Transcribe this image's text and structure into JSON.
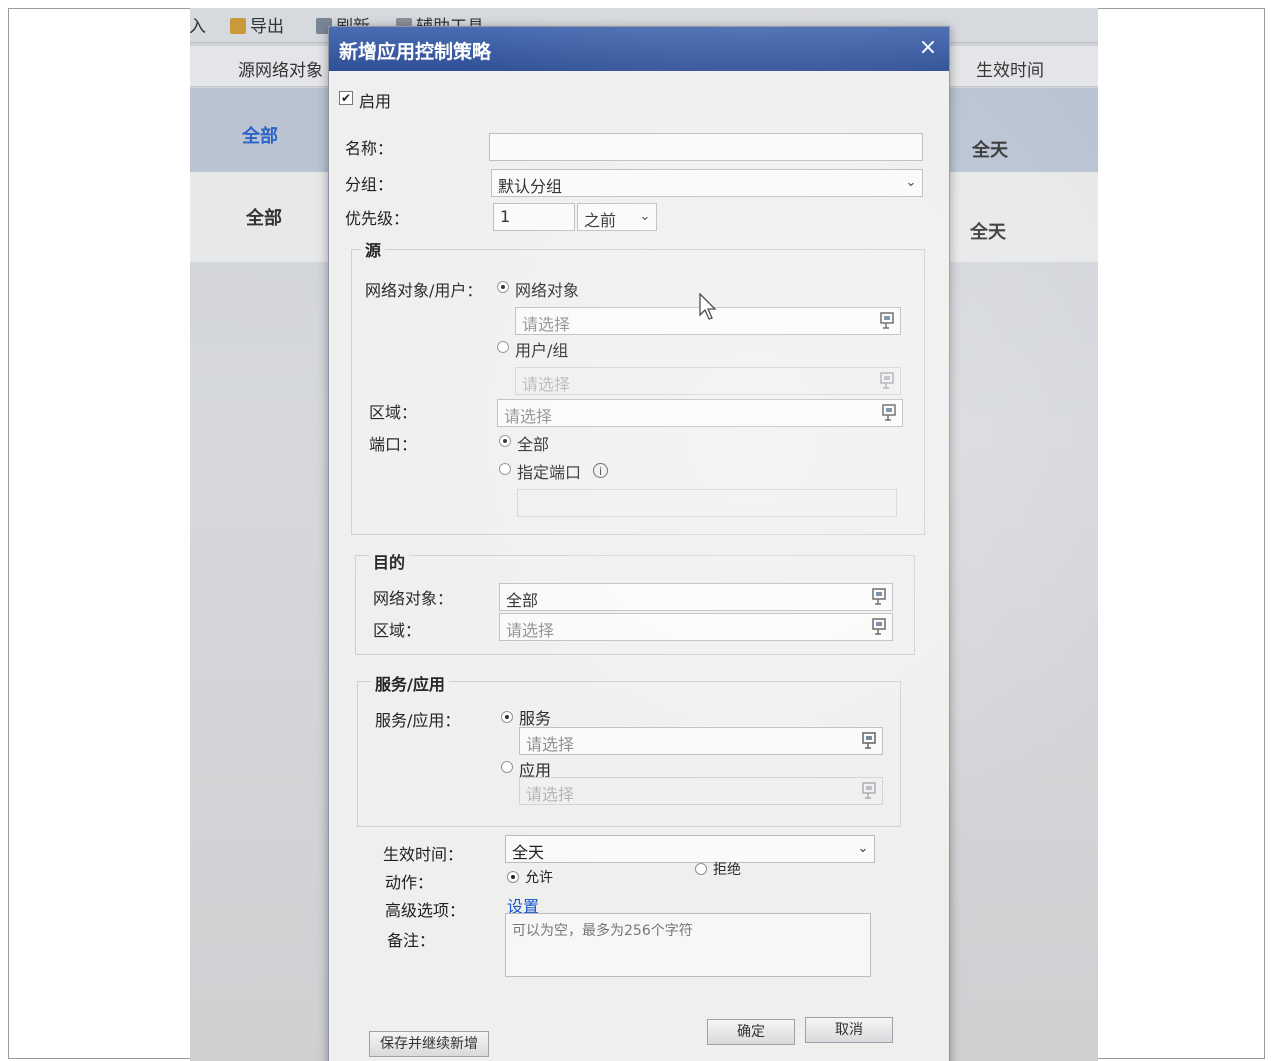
{
  "background": {
    "toolbar": {
      "import_label": "导入",
      "export_label": "导出",
      "refresh_label": "刷新",
      "tools_label": "辅助工具"
    },
    "table_header": {
      "col_source": "源网络对象",
      "col_time": "生效时间"
    },
    "rows": [
      {
        "source": "全部",
        "time": "全天"
      },
      {
        "source": "全部",
        "time": "全天"
      }
    ]
  },
  "dialog": {
    "title": "新增应用控制策略",
    "close_glyph": "×",
    "enable_label": "启用",
    "enable_checked": true,
    "name": {
      "label": "名称：",
      "value": ""
    },
    "group": {
      "label": "分组：",
      "value": "默认分组"
    },
    "priority": {
      "label": "优先级：",
      "value": "1",
      "position_value": "之前"
    },
    "source": {
      "legend": "源",
      "net_user_label": "网络对象/用户：",
      "net_object_option": "网络对象",
      "net_object_placeholder": "请选择",
      "user_group_option": "用户/组",
      "user_group_placeholder": "请选择",
      "zone_label": "区域：",
      "zone_placeholder": "请选择",
      "port_label": "端口：",
      "port_all_option": "全部",
      "port_specific_option": "指定端口",
      "info_glyph": "i",
      "port_value": ""
    },
    "destination": {
      "legend": "目的",
      "net_object_label": "网络对象：",
      "net_object_value": "全部",
      "zone_label": "区域：",
      "zone_placeholder": "请选择"
    },
    "service_app": {
      "legend": "服务/应用",
      "label": "服务/应用：",
      "service_option": "服务",
      "service_placeholder": "请选择",
      "app_option": "应用",
      "app_placeholder": "请选择"
    },
    "effective_time": {
      "label": "生效时间：",
      "value": "全天"
    },
    "action": {
      "label": "动作：",
      "allow_option": "允许",
      "deny_option": "拒绝"
    },
    "advanced": {
      "label": "高级选项：",
      "link": "设置"
    },
    "remark": {
      "label": "备注：",
      "placeholder": "可以为空，最多为256个字符"
    },
    "buttons": {
      "save_continue": "保存并继续新增",
      "ok": "确定",
      "cancel": "取消"
    },
    "arrow_glyph": "⌄",
    "check_glyph": "✔"
  },
  "colors": {
    "title_bar": "#3a5ca6",
    "link": "#1a56c8",
    "selected_row": "#b9c3d2"
  }
}
